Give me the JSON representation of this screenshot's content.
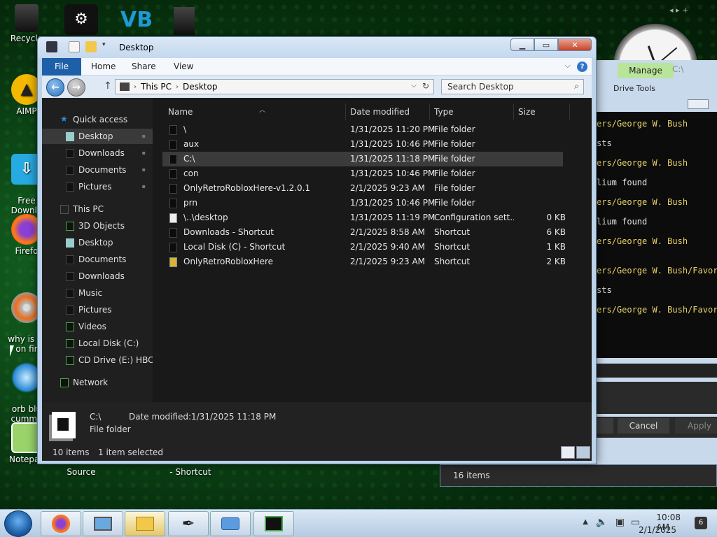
{
  "desktop": {
    "icons": [
      {
        "label": "Recycle",
        "icon": "recycle-bin-icon"
      },
      {
        "label": "AIMP",
        "icon": "aimp-icon"
      },
      {
        "label": "Free\nDownlo",
        "icon": "free-download-manager-icon"
      },
      {
        "label": "Firefo",
        "icon": "firefox-icon"
      },
      {
        "label": "why is m\non fir",
        "icon": "cd-icon"
      },
      {
        "label": "orb blu\ncumme",
        "icon": "orb-icon"
      },
      {
        "label": "Notepac",
        "icon": "notepad-icon"
      }
    ],
    "bottom_labels": [
      "Source",
      "- Shortcut"
    ]
  },
  "explorer": {
    "title": "Desktop",
    "ribbon_tabs": [
      "File",
      "Home",
      "Share",
      "View"
    ],
    "help": "?",
    "address": {
      "crumbs": [
        "This PC",
        "Desktop"
      ]
    },
    "search_placeholder": "Search Desktop",
    "nav": {
      "quick_access": "Quick access",
      "quick_items": [
        "Desktop",
        "Downloads",
        "Documents",
        "Pictures"
      ],
      "this_pc": "This PC",
      "pc_items": [
        "3D Objects",
        "Desktop",
        "Documents",
        "Downloads",
        "Music",
        "Pictures",
        "Videos",
        "Local Disk (C:)",
        "CD Drive (E:) HBCD_"
      ],
      "network": "Network"
    },
    "columns": [
      "Name",
      "Date modified",
      "Type",
      "Size"
    ],
    "files": [
      {
        "name": "\\",
        "date": "1/31/2025 11:20 PM",
        "type": "File folder",
        "size": ""
      },
      {
        "name": "aux",
        "date": "1/31/2025 10:46 PM",
        "type": "File folder",
        "size": ""
      },
      {
        "name": "C:\\",
        "date": "1/31/2025 11:18 PM",
        "type": "File folder",
        "size": ""
      },
      {
        "name": "con",
        "date": "1/31/2025 10:46 PM",
        "type": "File folder",
        "size": ""
      },
      {
        "name": "OnlyRetroRobloxHere-v1.2.0.1",
        "date": "2/1/2025 9:23 AM",
        "type": "File folder",
        "size": ""
      },
      {
        "name": "prn",
        "date": "1/31/2025 10:46 PM",
        "type": "File folder",
        "size": ""
      },
      {
        "name": "\\..\\desktop",
        "date": "1/31/2025 11:19 PM",
        "type": "Configuration sett...",
        "size": "0 KB"
      },
      {
        "name": "Downloads - Shortcut",
        "date": "2/1/2025 8:58 AM",
        "type": "Shortcut",
        "size": "6 KB"
      },
      {
        "name": "Local Disk (C) - Shortcut",
        "date": "2/1/2025 9:40 AM",
        "type": "Shortcut",
        "size": "1 KB"
      },
      {
        "name": "OnlyRetroRobloxHere",
        "date": "2/1/2025 9:23 AM",
        "type": "Shortcut",
        "size": "2 KB"
      }
    ],
    "details": {
      "name": "C:\\",
      "kind": "File folder",
      "date_label": "Date modified:",
      "date_value": "1/31/2025 11:18 PM"
    },
    "status": {
      "items": "10 items",
      "selected": "1 item selected"
    }
  },
  "background": {
    "manage_tab": "Manage",
    "drive_tools": "Drive Tools",
    "path_stub": "C:\\",
    "terminal_lines": [
      "ers/George W. Bush",
      "sts",
      "ers/George W. Bush",
      "lium found",
      "ers/George W. Bush",
      "lium found",
      "ers/George W. Bush",
      "ers/George W. Bush/Favor",
      "sts",
      "ers/George W. Bush/Favor"
    ],
    "cancel": "Cancel",
    "apply": "Apply",
    "items_count": "16 items"
  },
  "taskbar": {
    "time": "10:08 AM",
    "date": "2/1/2025",
    "notif_count": "6"
  }
}
